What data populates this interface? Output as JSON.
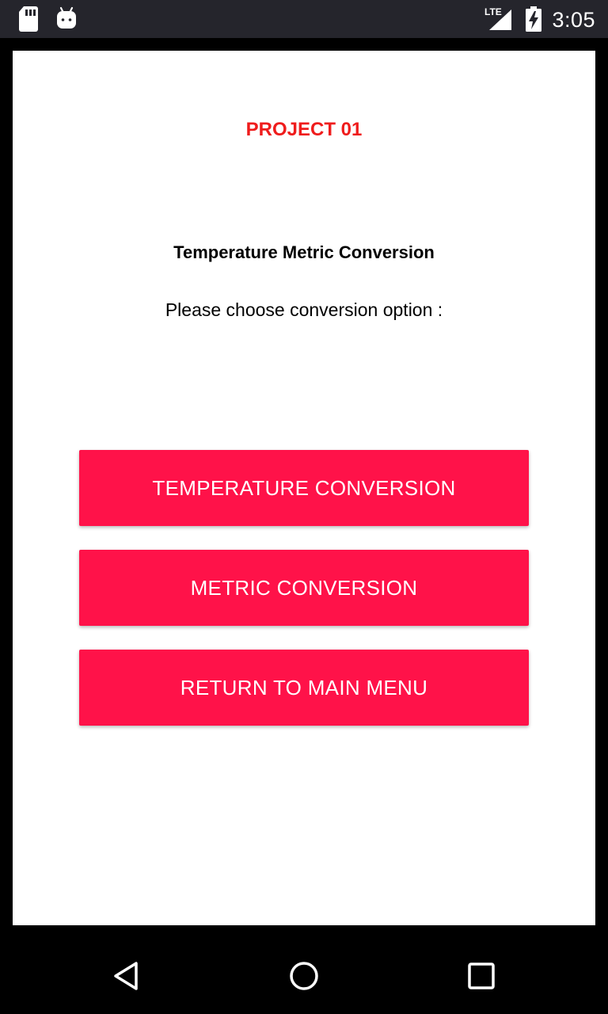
{
  "status_bar": {
    "time": "3:05",
    "network_label": "LTE",
    "icons": [
      "sd-card-icon",
      "android-debug-icon",
      "lte-signal-icon",
      "battery-charging-icon"
    ]
  },
  "app": {
    "project_title": "PROJECT 01",
    "heading": "Temperature Metric Conversion",
    "prompt": "Please choose conversion option :",
    "buttons": {
      "temperature": "TEMPERATURE CONVERSION",
      "metric": "METRIC CONVERSION",
      "return": "RETURN TO MAIN MENU"
    }
  },
  "nav_bar": {
    "icons": [
      "back-icon",
      "home-icon",
      "recents-icon"
    ]
  },
  "colors": {
    "accent": "#ff1249",
    "title_red": "#ef1c1c",
    "status_bar": "#25252c"
  }
}
